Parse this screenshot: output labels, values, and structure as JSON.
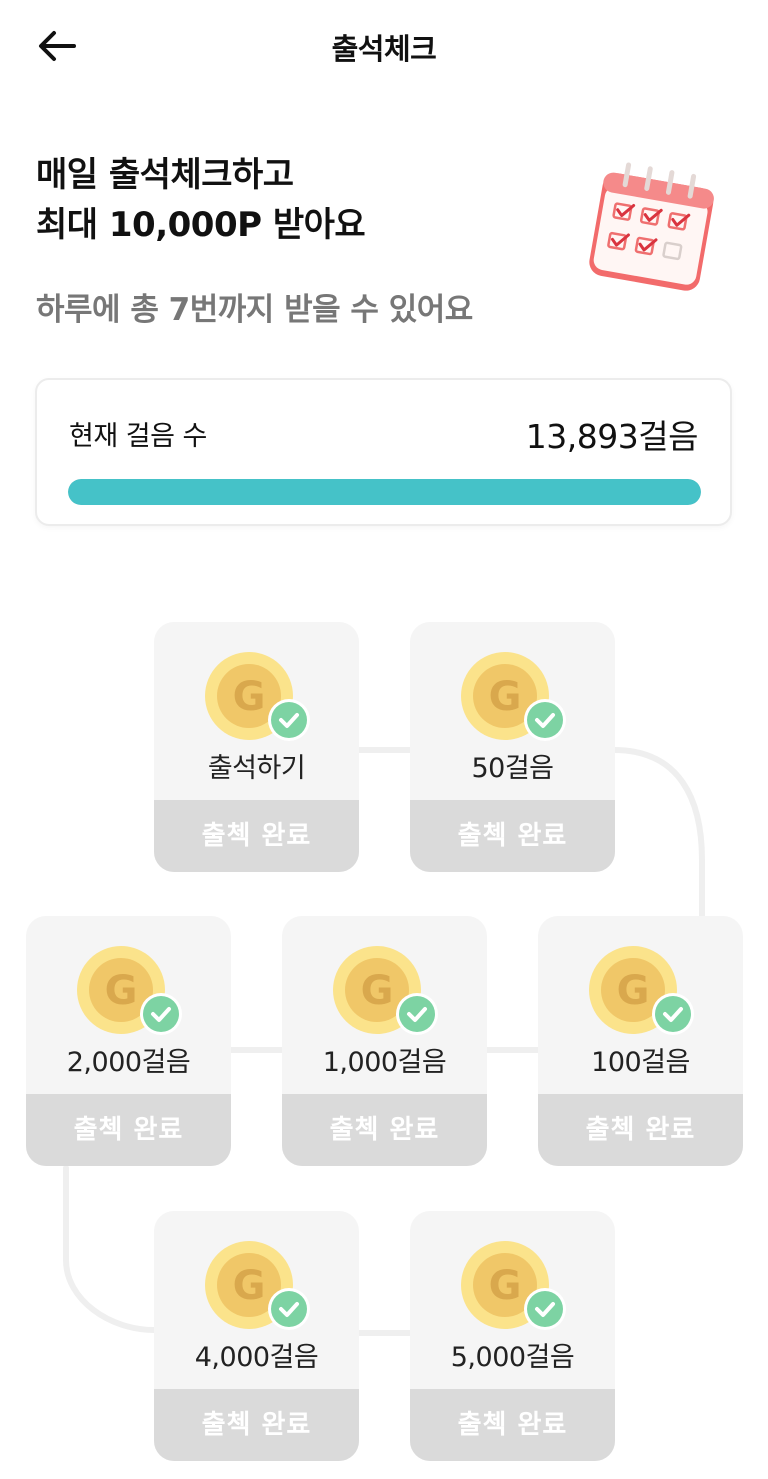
{
  "header": {
    "title": "출석체크"
  },
  "hero": {
    "headline_line1": "매일 출석체크하고",
    "headline_line2": "최대 10,000P 받아요",
    "subtitle": "하루에 총 7번까지 받을 수 있어요"
  },
  "steps": {
    "label": "현재 걸음 수",
    "value": "13,893걸음",
    "progress_fraction": 1.0,
    "progress_color": "#45c2c8"
  },
  "milestones": [
    {
      "label": "출석하기",
      "status": "출첵 완료",
      "icon": "gold-coin-icon",
      "checked": true
    },
    {
      "label": "50걸음",
      "status": "출첵 완료",
      "icon": "gold-coin-icon",
      "checked": true
    },
    {
      "label": "100걸음",
      "status": "출첵 완료",
      "icon": "gold-coin-icon",
      "checked": true
    },
    {
      "label": "1,000걸음",
      "status": "출첵 완료",
      "icon": "gold-coin-icon",
      "checked": true
    },
    {
      "label": "2,000걸음",
      "status": "출첵 완료",
      "icon": "gold-coin-icon",
      "checked": true
    },
    {
      "label": "4,000걸음",
      "status": "출첵 완료",
      "icon": "gold-coin-icon",
      "checked": true
    },
    {
      "label": "5,000걸음",
      "status": "출첵 완료",
      "icon": "gold-coin-icon",
      "checked": true
    }
  ],
  "colors": {
    "check_badge": "#7dd3a3",
    "coin_outer": "#fbe38b",
    "coin_inner": "#f0c768",
    "done_status_bg": "#dadada",
    "calendar_red": "#f26b6b"
  }
}
